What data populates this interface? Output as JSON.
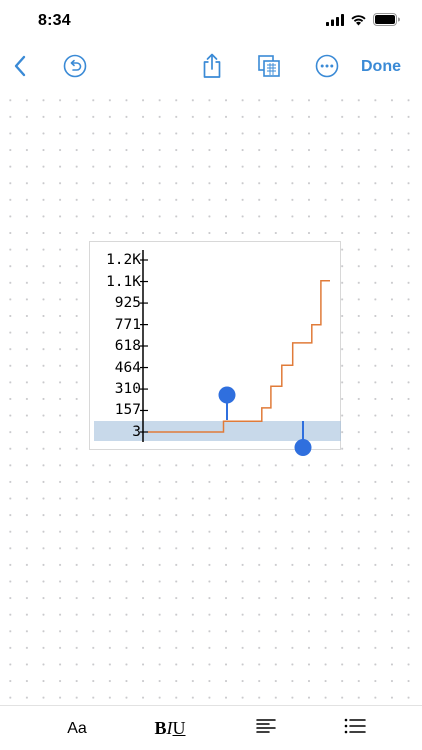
{
  "status_bar": {
    "time": "8:34",
    "icons": [
      "signal-icon",
      "wifi-icon",
      "battery-icon"
    ]
  },
  "toolbar": {
    "back_icon": "chevron-left-icon",
    "undo_icon": "undo-icon",
    "share_icon": "share-icon",
    "copy_icon": "copy-icon",
    "more_icon": "more-icon",
    "done_label": "Done",
    "accent_color": "#3a8ad6"
  },
  "chart_data": {
    "type": "line",
    "title": "",
    "xlabel": "",
    "ylabel": "",
    "y_ticks": [
      "1.2K",
      "1.1K",
      "925",
      "771",
      "618",
      "464",
      "310",
      "157",
      "3"
    ],
    "y_tick_values": [
      1233,
      1079,
      925,
      771,
      618,
      464,
      310,
      157,
      3
    ],
    "ylim": [
      3,
      1233
    ],
    "line_color": "#e07b39",
    "series": [
      {
        "values": [
          3,
          3,
          3,
          3,
          3,
          3,
          3,
          3,
          3,
          3,
          3,
          3,
          3,
          3,
          3,
          3,
          3,
          3,
          3,
          3,
          3,
          3,
          3,
          3,
          3,
          3,
          3,
          3,
          3,
          3,
          3,
          3,
          3,
          3,
          3,
          3,
          3,
          3,
          3,
          3,
          3,
          3,
          3,
          3,
          3,
          3,
          3,
          3,
          3,
          3,
          3,
          3,
          3,
          3,
          3,
          3,
          3,
          3,
          3,
          3,
          3,
          3,
          3,
          3,
          3,
          3,
          3,
          3,
          3,
          3,
          3,
          3,
          3,
          3,
          3,
          3,
          3,
          3,
          3,
          3,
          3,
          3,
          3,
          80,
          80,
          80,
          80,
          80,
          80,
          80,
          80,
          80,
          80,
          80,
          80,
          80,
          80,
          80,
          80,
          80,
          80,
          80,
          80,
          80,
          80,
          80,
          80,
          80,
          80,
          80,
          80,
          80,
          80,
          80,
          80,
          80,
          80,
          80,
          80,
          80,
          80,
          80,
          80,
          80,
          80,
          175,
          175,
          175,
          175,
          175,
          175,
          175,
          175,
          175,
          175,
          330,
          330,
          330,
          330,
          330,
          330,
          330,
          330,
          330,
          330,
          330,
          330,
          480,
          480,
          480,
          480,
          480,
          480,
          480,
          480,
          480,
          480,
          480,
          480,
          640,
          640,
          640,
          640,
          640,
          640,
          640,
          640,
          640,
          640,
          640,
          640,
          640,
          640,
          640,
          640,
          640,
          640,
          640,
          640,
          640,
          770,
          770,
          770,
          770,
          770,
          770,
          770,
          770,
          770,
          770,
          1085,
          1085,
          1085,
          1085,
          1085,
          1085,
          1085,
          1085,
          1085,
          1085,
          1085
        ]
      }
    ],
    "selection_band_color": "#a4c0dc",
    "handle_color": "#2f6fde"
  },
  "format_bar": {
    "text_style_label": "Aa",
    "bold_label": "B",
    "italic_label": "I",
    "underline_label": "U",
    "align_icon": "align-left-icon",
    "list_icon": "list-icon"
  }
}
